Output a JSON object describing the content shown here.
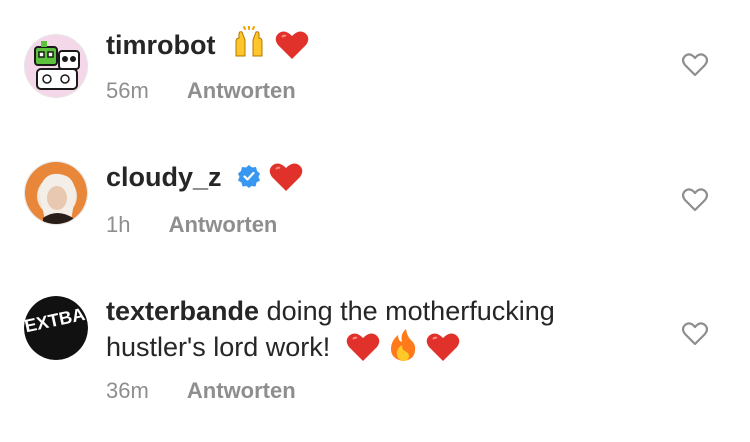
{
  "comments": [
    {
      "username": "timrobot",
      "text": "",
      "verified": false,
      "emojis": [
        "raising-hands",
        "red-heart"
      ],
      "time": "56m",
      "reply_label": "Antworten"
    },
    {
      "username": "cloudy_z",
      "text": "",
      "verified": true,
      "emojis": [
        "red-heart"
      ],
      "time": "1h",
      "reply_label": "Antworten"
    },
    {
      "username": "texterbande",
      "text_line1": "doing the motherfucking",
      "text_line2": "hustler's lord work!",
      "verified": false,
      "emojis": [
        "red-heart",
        "fire",
        "red-heart"
      ],
      "time": "36m",
      "reply_label": "Antworten",
      "avatar_text": "EXTBA"
    }
  ],
  "colors": {
    "text": "#262626",
    "secondary": "#8e8e8e",
    "heart": "#e0312b",
    "verified": "#3897f0",
    "like_icon": "#8e8e8e"
  },
  "icons": [
    "raising-hands-icon",
    "heart-emoji-icon",
    "fire-icon",
    "verified-badge-icon",
    "like-heart-icon"
  ]
}
